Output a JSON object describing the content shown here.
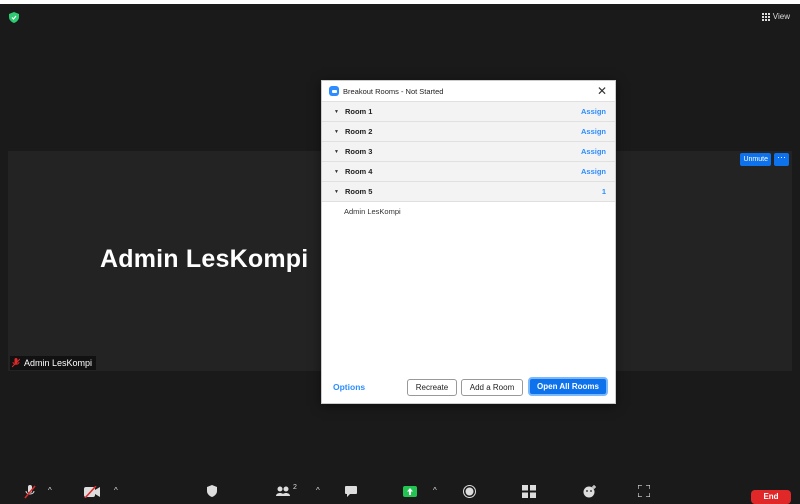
{
  "top_bar": {
    "view_label": "View"
  },
  "tile": {
    "participant_name": "Admin LesKompi",
    "name_tag": "Admin LesKompi",
    "unmute_label": "Unmute",
    "more_label": "···"
  },
  "dialog": {
    "title": "Breakout Rooms - Not Started",
    "close": "✕",
    "rooms": [
      {
        "name": "Room 1",
        "action": "Assign"
      },
      {
        "name": "Room 2",
        "action": "Assign"
      },
      {
        "name": "Room 3",
        "action": "Assign"
      },
      {
        "name": "Room 4",
        "action": "Assign"
      },
      {
        "name": "Room 5",
        "action": "1"
      }
    ],
    "room5_member": "Admin LesKompi",
    "options_label": "Options",
    "recreate_label": "Recreate",
    "add_room_label": "Add a Room",
    "open_all_label": "Open All Rooms"
  },
  "toolbar": {
    "participants_count": "2",
    "end_label": "End"
  },
  "colors": {
    "accent": "#0e72ed",
    "link": "#2d8cff",
    "end": "#e02828"
  }
}
